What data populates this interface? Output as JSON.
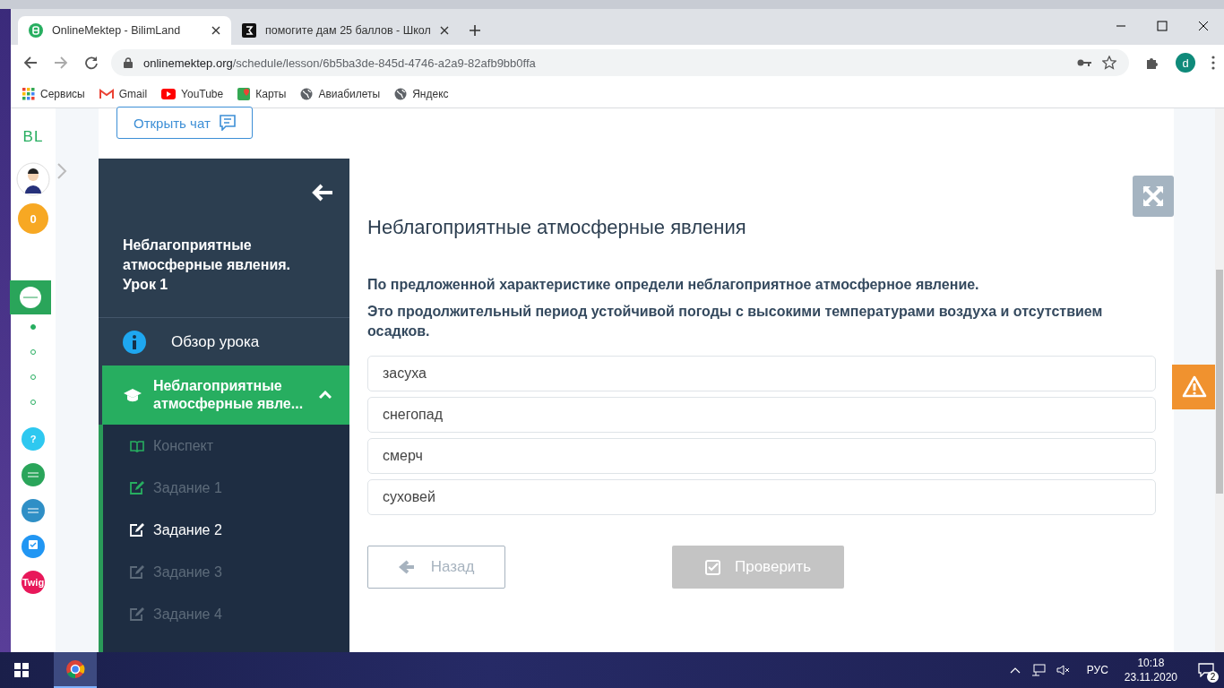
{
  "browser": {
    "tabs": [
      {
        "title": "OnlineMektep - BilimLand",
        "selected": true
      },
      {
        "title": "помогите дам 25 баллов - Школ",
        "selected": false
      }
    ],
    "url_host": "onlinemektep.org",
    "url_path": "/schedule/lesson/6b5ba3de-845d-4746-a2a9-82afb9bb0ffa",
    "profile_initial": "d",
    "bookmarks": [
      {
        "label": "Сервисы",
        "kind": "apps"
      },
      {
        "label": "Gmail",
        "kind": "gmail"
      },
      {
        "label": "YouTube",
        "kind": "youtube"
      },
      {
        "label": "Карты",
        "kind": "maps"
      },
      {
        "label": "Авиабилеты",
        "kind": "globe"
      },
      {
        "label": "Яндекс",
        "kind": "globe"
      }
    ]
  },
  "rail": {
    "logo": "BL",
    "coins": "0",
    "steps": [
      {
        "selected": true
      },
      {
        "selected": false
      },
      {
        "selected": false
      },
      {
        "selected": false
      }
    ],
    "apps": [
      {
        "kind": "help",
        "label": "?",
        "color": "#2ec8f0"
      },
      {
        "kind": "app",
        "color": "#2aa55a"
      },
      {
        "kind": "app",
        "color": "#2f8fc6"
      },
      {
        "kind": "test",
        "color": "#2196f3"
      },
      {
        "kind": "twig",
        "label": "Twig",
        "color": "#e8185a"
      }
    ]
  },
  "chat_button": "Открыть чат",
  "lesson_menu": {
    "title": "Неблагоприятные атмосферные явления. Урок 1",
    "overview": "Обзор урока",
    "section": {
      "title": "Неблагоприятные атмосферные явле...",
      "expanded": true
    },
    "items": [
      {
        "label": "Конспект",
        "kind": "notes",
        "done": true,
        "selected": false
      },
      {
        "label": "Задание 1",
        "kind": "task",
        "done": true,
        "selected": false
      },
      {
        "label": "Задание 2",
        "kind": "task",
        "done": false,
        "selected": true
      },
      {
        "label": "Задание 3",
        "kind": "task",
        "done": false,
        "selected": false
      },
      {
        "label": "Задание 4",
        "kind": "task",
        "done": false,
        "selected": false
      }
    ]
  },
  "task": {
    "heading": "Неблагоприятные атмосферные явления",
    "question": [
      "По предложенной характеристике определи неблагоприятное атмосферное явление.",
      "Это продолжительный период устойчивой погоды с высокими температурами воздуха и отсутствием осадков."
    ],
    "options": [
      {
        "label": "засуха",
        "selected": false
      },
      {
        "label": "снегопад",
        "selected": false
      },
      {
        "label": "смерч",
        "selected": false
      },
      {
        "label": "суховей",
        "selected": false
      }
    ],
    "back_button": "Назад",
    "check_button": {
      "label": "Проверить",
      "disabled": true
    }
  },
  "taskbar": {
    "language": "РУС",
    "time": "10:18",
    "date": "23.11.2020",
    "notifications": "2"
  }
}
